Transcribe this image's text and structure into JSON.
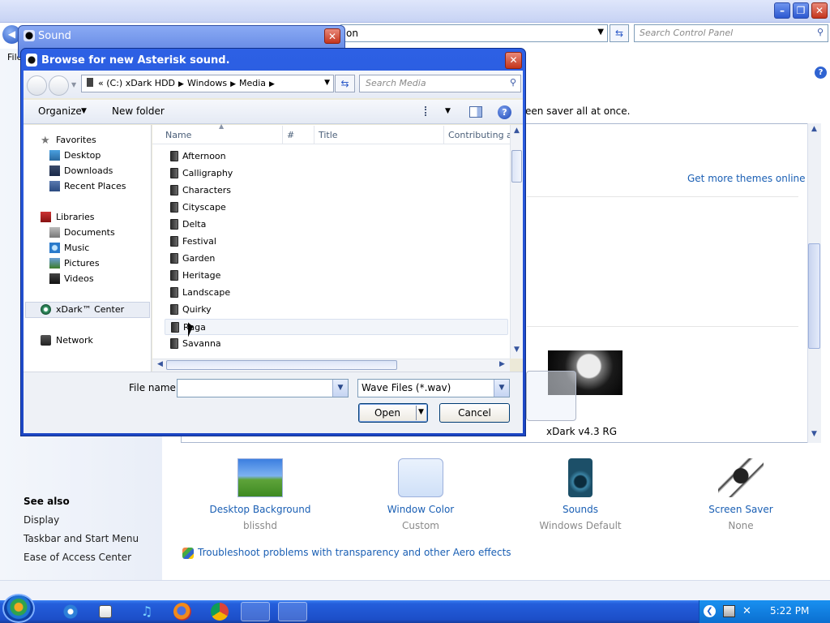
{
  "control_panel": {
    "address_partial": "on",
    "search_placeholder": "Search Control Panel",
    "help_glyph": "?",
    "screen_saver_text": "een saver all at once.",
    "get_more_themes": "Get more themes online",
    "theme_name": "xDark v4.3 RG",
    "file_menu_partial": "File",
    "items": [
      {
        "title": "Desktop Background",
        "subtitle": "blisshd",
        "icon": "desktop-background-icon"
      },
      {
        "title": "Window Color",
        "subtitle": "Custom",
        "icon": "window-color-icon"
      },
      {
        "title": "Sounds",
        "subtitle": "Windows Default",
        "icon": "speaker-icon"
      },
      {
        "title": "Screen Saver",
        "subtitle": "None",
        "icon": "screen-saver-icon"
      }
    ],
    "see_also": {
      "heading": "See also",
      "links": [
        "Display",
        "Taskbar and Start Menu",
        "Ease of Access Center"
      ]
    },
    "troubleshoot": "Troubleshoot problems with transparency and other Aero effects"
  },
  "sound_dialog": {
    "title": "Sound",
    "close_glyph": "✕"
  },
  "browse_dialog": {
    "title": "Browse for new Asterisk sound.",
    "close_glyph": "✕",
    "breadcrumb": {
      "prefix": "«",
      "parts": [
        "(C:) xDark HDD",
        "Windows",
        "Media"
      ]
    },
    "search_placeholder": "Search Media",
    "toolbar": {
      "organize": "Organize",
      "new_folder": "New folder"
    },
    "nav": {
      "favorites": "Favorites",
      "favorites_items": [
        "Desktop",
        "Downloads",
        "Recent Places"
      ],
      "libraries": "Libraries",
      "libraries_items": [
        "Documents",
        "Music",
        "Pictures",
        "Videos"
      ],
      "center": "xDark™ Center",
      "network": "Network"
    },
    "columns": [
      "Name",
      "#",
      "Title",
      "Contributing art"
    ],
    "folders": [
      "Afternoon",
      "Calligraphy",
      "Characters",
      "Cityscape",
      "Delta",
      "Festival",
      "Garden",
      "Heritage",
      "Landscape",
      "Quirky",
      "Raga",
      "Savanna"
    ],
    "hovered_folder": "Raga",
    "file_name_label": "File name:",
    "file_name_value": "",
    "file_type": "Wave Files (*.wav)",
    "open_label": "Open",
    "cancel_label": "Cancel"
  },
  "taskbar": {
    "clock": "5:22 PM",
    "icons": [
      "start-orb-icon",
      "internet-explorer-icon",
      "checkbox-app-icon",
      "music-note-icon",
      "firefox-icon",
      "chrome-icon",
      "media-app-icon",
      "sound-app-icon"
    ]
  },
  "colors": {
    "title_blue": "#245edb",
    "link_blue": "#1a5fb4",
    "dialog_bg": "#ece9d8"
  }
}
